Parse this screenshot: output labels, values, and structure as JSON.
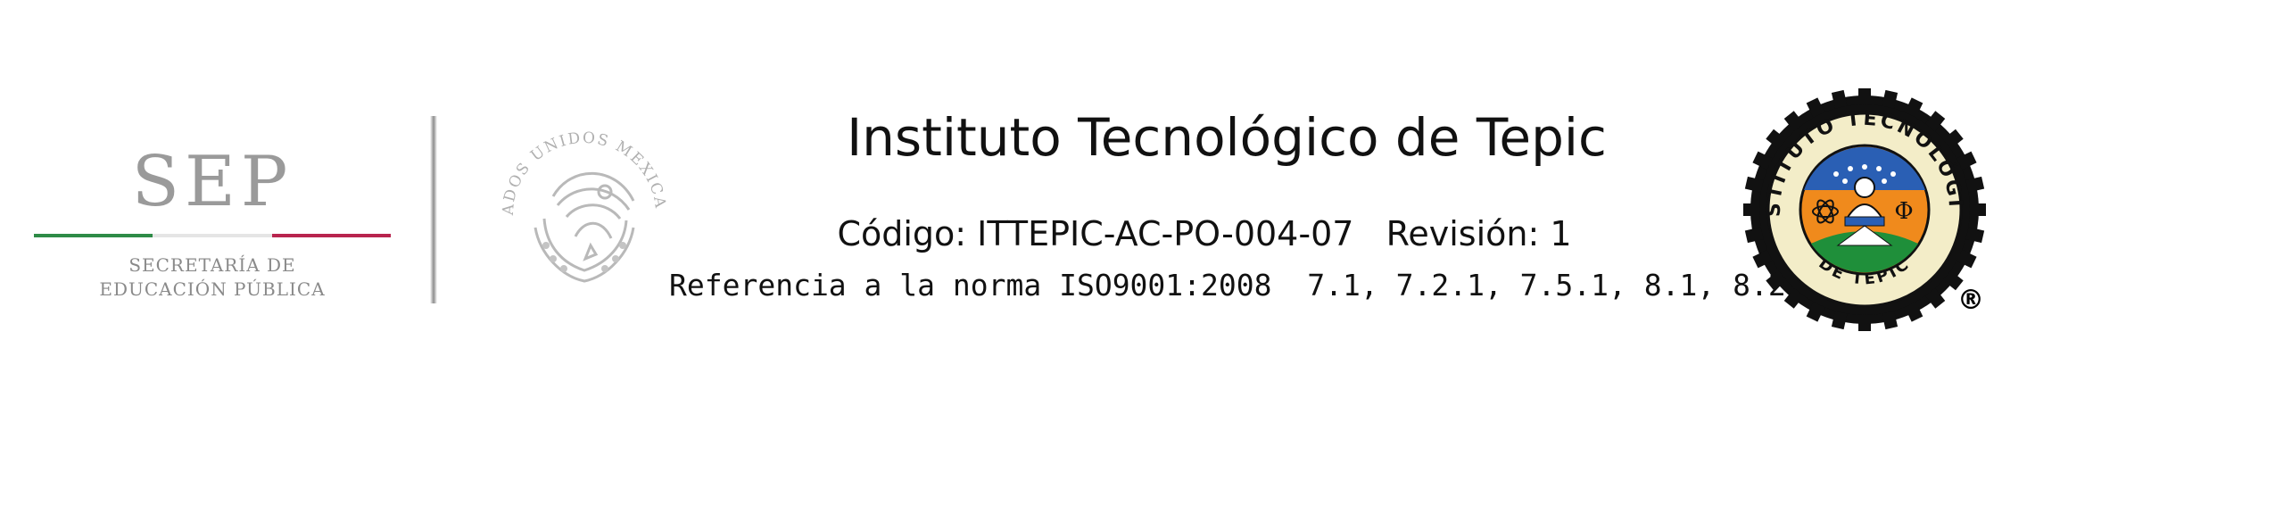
{
  "header": {
    "sep_logo": {
      "title": "SEP",
      "subtitle_line1": "SECRETARÍA DE",
      "subtitle_line2": "EDUCACIÓN PÚBLICA",
      "colors": {
        "green": "#2e8b47",
        "white": "#e5e5e5",
        "red": "#b8244e",
        "text": "#9a9a9a"
      }
    },
    "national_seal": {
      "icon": "mexican-coat-of-arms-icon",
      "arc_text": "ESTADOS UNIDOS MEXICANOS"
    },
    "institution_name": "Instituto Tecnológico de Tepic",
    "code_label": "Código: ITTEPIC-AC-PO-004-07",
    "revision_label": "Revisión: 1",
    "reference_label": "Referencia a la norma ISO9001:2008",
    "reference_clauses": "7.1, 7.2.1, 7.5.1, 8.1, 8.2.4",
    "itt_seal": {
      "icon": "instituto-tecnologico-gear-seal-icon",
      "arc_top": "INSTITUTO TECNOLÓGICO",
      "arc_bottom": "DE TEPIC",
      "colors": {
        "gear": "#111111",
        "ring": "#f3edc8",
        "orange": "#f08a1c",
        "blue": "#2a5fb4",
        "green": "#1f8f3a"
      }
    },
    "registered_mark": "®"
  }
}
